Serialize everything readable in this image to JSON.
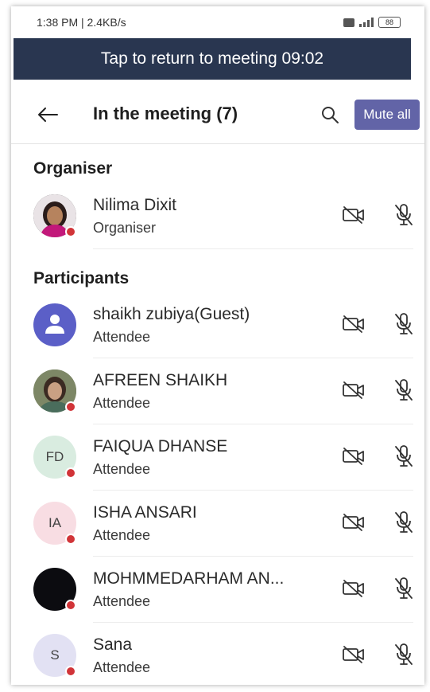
{
  "status_bar": {
    "time_speed": "1:38 PM | 2.4KB/s",
    "battery": "88"
  },
  "banner": {
    "text": "Tap to return to meeting 09:02"
  },
  "header": {
    "title": "In the meeting (7)",
    "mute_all_label": "Mute all"
  },
  "colors": {
    "banner_bg": "#293650",
    "accent": "#6264a7",
    "presence_busy": "#d13438"
  },
  "sections": {
    "organiser_heading": "Organiser",
    "participants_heading": "Participants"
  },
  "organiser": {
    "name": "Nilima Dixit",
    "role": "Organiser",
    "avatar": "photo"
  },
  "participants": [
    {
      "name": "shaikh zubiya(Guest)",
      "role": "Attendee",
      "avatar": "person-icon"
    },
    {
      "name": "AFREEN SHAIKH",
      "role": "Attendee",
      "avatar": "photo"
    },
    {
      "name": "FAIQUA DHANSE",
      "role": "Attendee",
      "initials": "FD"
    },
    {
      "name": "ISHA ANSARI",
      "role": "Attendee",
      "initials": "IA"
    },
    {
      "name": "MOHMMEDARHAM AN...",
      "role": "Attendee",
      "avatar": "dark-photo"
    },
    {
      "name": "Sana",
      "role": "Attendee",
      "initials": "S"
    }
  ],
  "icons": {
    "back": "arrow-left-icon",
    "search": "search-icon",
    "camera": "camera-off-icon",
    "mic": "mic-off-icon"
  }
}
